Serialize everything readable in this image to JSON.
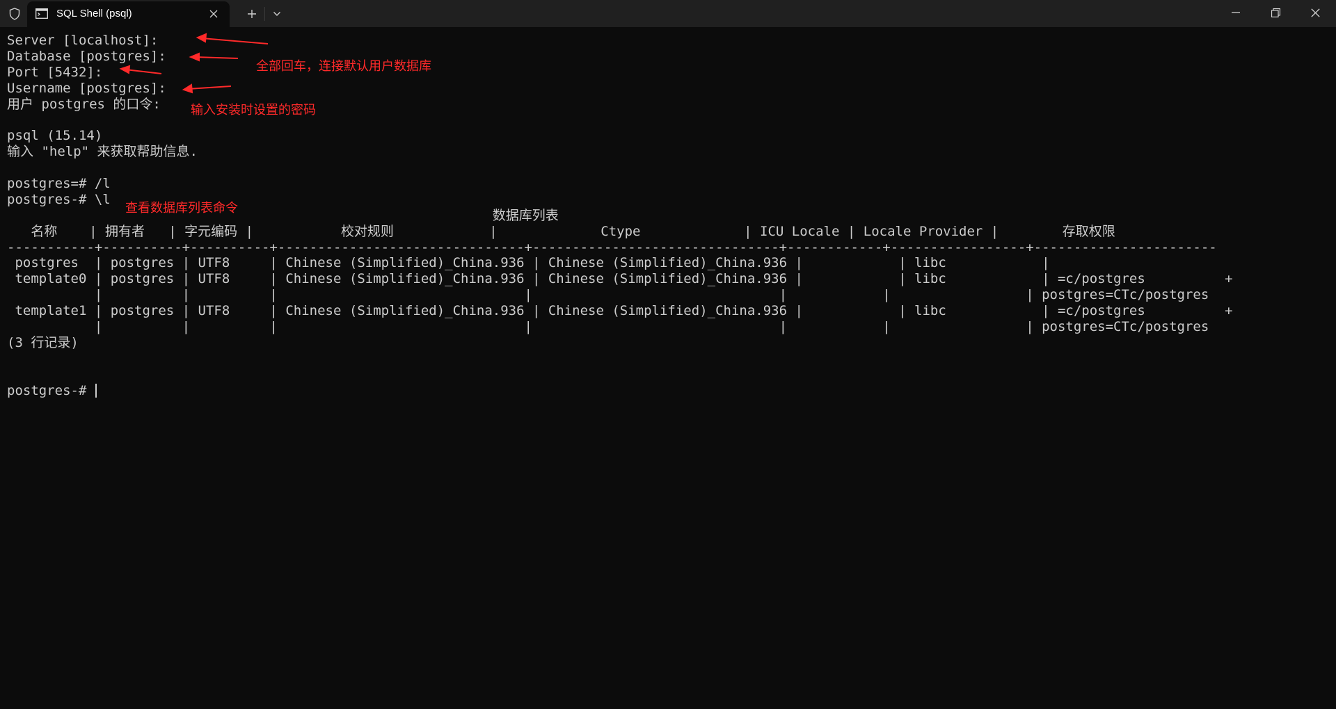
{
  "window": {
    "tab_title": "SQL Shell (psql)",
    "icons": {
      "shield": "shield-icon",
      "terminal": "terminal-icon",
      "close_tab": "close-icon",
      "new_tab": "plus-icon",
      "dropdown": "chevron-down-icon",
      "minimize": "minimize-icon",
      "restore": "restore-icon",
      "close": "close-icon"
    }
  },
  "colors": {
    "terminal_bg": "#0c0c0c",
    "terminal_fg": "#cccccc",
    "titlebar_bg": "#202020",
    "annotation": "#ff2a2a"
  },
  "terminal": {
    "lines": [
      "Server [localhost]:",
      "Database [postgres]:",
      "Port [5432]:",
      "Username [postgres]:",
      "用户 postgres 的口令:",
      "",
      "psql (15.14)",
      "输入 \"help\" 来获取帮助信息.",
      "",
      "postgres=# /l",
      "postgres-# \\l",
      "                                                             数据库列表",
      "   名称    | 拥有者   | 字元编码 |           校对规则            |             Ctype             | ICU Locale | Locale Provider |        存取权限",
      "-----------+----------+----------+-------------------------------+-------------------------------+------------+-----------------+-----------------------",
      " postgres  | postgres | UTF8     | Chinese (Simplified)_China.936 | Chinese (Simplified)_China.936 |            | libc            |",
      " template0 | postgres | UTF8     | Chinese (Simplified)_China.936 | Chinese (Simplified)_China.936 |            | libc            | =c/postgres          +",
      "           |          |          |                               |                               |            |                 | postgres=CTc/postgres",
      " template1 | postgres | UTF8     | Chinese (Simplified)_China.936 | Chinese (Simplified)_China.936 |            | libc            | =c/postgres          +",
      "           |          |          |                               |                               |            |                 | postgres=CTc/postgres",
      "(3 行记录)",
      "",
      "",
      "postgres-# "
    ]
  },
  "annotations": {
    "enter_all": "全部回车，连接默认用户数据库",
    "enter_password": "输入安装时设置的密码",
    "list_command": "查看数据库列表命令"
  }
}
